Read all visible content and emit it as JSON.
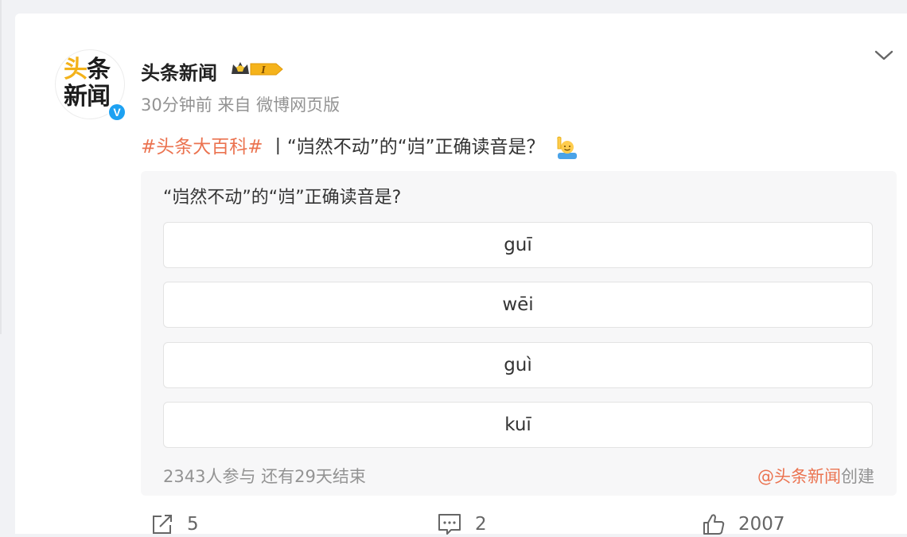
{
  "account": {
    "name": "头条新闻",
    "avatar_line1_yellow": "头",
    "avatar_line1_black": "条",
    "avatar_line2": "新闻",
    "verified_mark": "V",
    "badge_text": "I",
    "badge_icon": "crown-level-badge-icon"
  },
  "post": {
    "time": "30分钟前",
    "source": "来自 微博网页版",
    "hashtag": "#头条大百科#",
    "separator": "丨",
    "text": "“岿然不动”的“岿”正确读音是？",
    "emoji": "raising-hand-emoji"
  },
  "poll": {
    "question": "“岿然不动”的“岿”正确读音是?",
    "options": [
      "guī",
      "wēi",
      "guì",
      "kuī"
    ],
    "participants": "2343人参与",
    "time_left": "还有29天结束",
    "creator": "@头条新闻",
    "created_suffix": "创建"
  },
  "actions": {
    "share_count": "5",
    "comment_count": "2",
    "like_count": "2007"
  },
  "colors": {
    "accent": "#eb7350",
    "verified": "#1da1f2",
    "meta_gray": "#939393"
  }
}
